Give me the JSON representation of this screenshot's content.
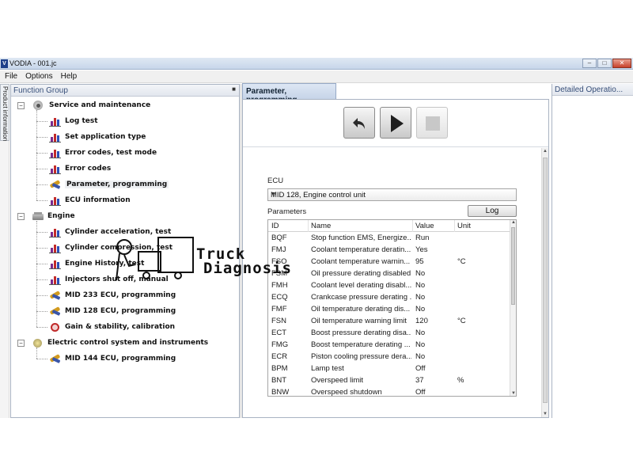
{
  "window": {
    "title": "VODIA - 001.jc"
  },
  "menu": [
    "File",
    "Options",
    "Help"
  ],
  "side_tab": {
    "label": "Product information"
  },
  "function_group": {
    "title": "Function Group",
    "tree": [
      {
        "label": "Service and maintenance",
        "level": 0,
        "icon": "service-icon",
        "expander": "−"
      },
      {
        "label": "Log test",
        "level": 1,
        "icon": "chart-icon"
      },
      {
        "label": "Set application type",
        "level": 1,
        "icon": "chart-icon"
      },
      {
        "label": "Error codes, test mode",
        "level": 1,
        "icon": "chart-icon"
      },
      {
        "label": "Error codes",
        "level": 1,
        "icon": "chart-icon"
      },
      {
        "label": "Parameter, programming",
        "level": 1,
        "icon": "wrench-icon",
        "selected": true
      },
      {
        "label": "ECU information",
        "level": 1,
        "icon": "chart-icon"
      },
      {
        "label": "Engine",
        "level": 0,
        "icon": "engine-icon",
        "expander": "−"
      },
      {
        "label": "Cylinder acceleration, test",
        "level": 1,
        "icon": "chart-icon"
      },
      {
        "label": "Cylinder compression, test",
        "level": 1,
        "icon": "chart-icon"
      },
      {
        "label": "Engine History, test",
        "level": 1,
        "icon": "chart-icon"
      },
      {
        "label": "Injectors shut off, manual",
        "level": 1,
        "icon": "chart-icon"
      },
      {
        "label": "MID 233 ECU, programming",
        "level": 1,
        "icon": "wrench-icon"
      },
      {
        "label": "MID 128 ECU, programming",
        "level": 1,
        "icon": "wrench-icon"
      },
      {
        "label": "Gain & stability, calibration",
        "level": 1,
        "icon": "gain-icon"
      },
      {
        "label": "Electric control system and instruments",
        "level": 0,
        "icon": "electric-icon",
        "expander": "−"
      },
      {
        "label": "MID 144 ECU, programming",
        "level": 1,
        "icon": "wrench-icon"
      }
    ]
  },
  "parameter_tab": {
    "label": "Parameter, programming"
  },
  "toolbar": {
    "back": "back-arrow-icon",
    "play": "play-icon",
    "stop": "stop-icon"
  },
  "ecu": {
    "label": "ECU",
    "selected": "MID 128, Engine control unit"
  },
  "parameters": {
    "label": "Parameters",
    "log_button": "Log",
    "columns": [
      "ID",
      "Name",
      "Value",
      "Unit"
    ],
    "rows": [
      {
        "id": "BQF",
        "name": "Stop function EMS, Energize...",
        "value": "Run",
        "unit": ""
      },
      {
        "id": "FMJ",
        "name": "Coolant temperature deratin...",
        "value": "Yes",
        "unit": ""
      },
      {
        "id": "FSO",
        "name": "Coolant temperature warnin...",
        "value": "95",
        "unit": "°C"
      },
      {
        "id": "FSM",
        "name": "Oil pressure derating disabled",
        "value": "No",
        "unit": ""
      },
      {
        "id": "FMH",
        "name": "Coolant level derating disabl...",
        "value": "No",
        "unit": ""
      },
      {
        "id": "ECQ",
        "name": "Crankcase pressure derating ...",
        "value": "No",
        "unit": ""
      },
      {
        "id": "FMF",
        "name": "Oil temperature derating dis...",
        "value": "No",
        "unit": ""
      },
      {
        "id": "FSN",
        "name": "Oil temperature warning limit",
        "value": "120",
        "unit": "°C"
      },
      {
        "id": "ECT",
        "name": "Boost pressure derating disa...",
        "value": "No",
        "unit": ""
      },
      {
        "id": "FMG",
        "name": "Boost temperature derating ...",
        "value": "No",
        "unit": ""
      },
      {
        "id": "ECR",
        "name": "Piston cooling pressure dera...",
        "value": "No",
        "unit": ""
      },
      {
        "id": "BPM",
        "name": "Lamp test",
        "value": "Off",
        "unit": ""
      },
      {
        "id": "BNT",
        "name": "Overspeed limit",
        "value": "37",
        "unit": "%"
      },
      {
        "id": "BNW",
        "name": "Overspeed shutdown",
        "value": "Off",
        "unit": ""
      }
    ]
  },
  "detail_panel": {
    "title": "Detailed Operatio..."
  },
  "watermark": {
    "line1": "Truck",
    "line2": "Diagnosis"
  }
}
